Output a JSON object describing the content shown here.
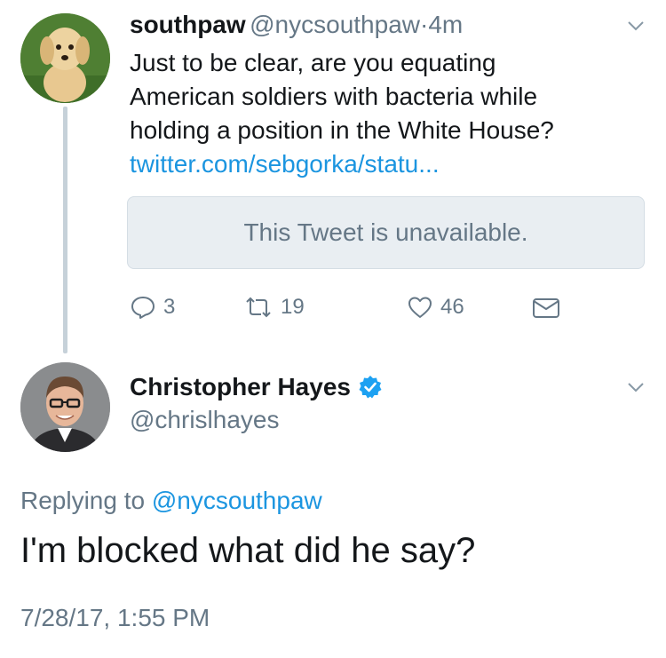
{
  "tweet1": {
    "display_name": "southpaw",
    "handle": "@nycsouthpaw",
    "separator": "·",
    "time": "4m",
    "text_line1": "Just to be clear, are you equating",
    "text_line2": "American soldiers with bacteria while",
    "text_line3": "holding a position in the White House?",
    "link": "twitter.com/sebgorka/statu...",
    "quoted_tweet_message": "This Tweet is unavailable.",
    "reply_count": "3",
    "retweet_count": "19",
    "like_count": "46"
  },
  "tweet2": {
    "display_name": "Christopher Hayes",
    "handle": "@chrislhayes",
    "replying_prefix": "Replying to",
    "replying_to": "@nycsouthpaw",
    "text": "I'm blocked what did he say?",
    "timestamp": "7/28/17, 1:55 PM"
  },
  "colors": {
    "link_blue": "#1b95e0",
    "secondary_gray": "#657786",
    "verified_blue": "#1da1f2",
    "thread_line": "#c6d1d9"
  },
  "icons": {
    "reply": "reply-icon",
    "retweet": "retweet-icon",
    "like": "heart-icon",
    "dm": "envelope-icon",
    "more": "chevron-down-icon",
    "verified": "verified-badge-icon"
  }
}
